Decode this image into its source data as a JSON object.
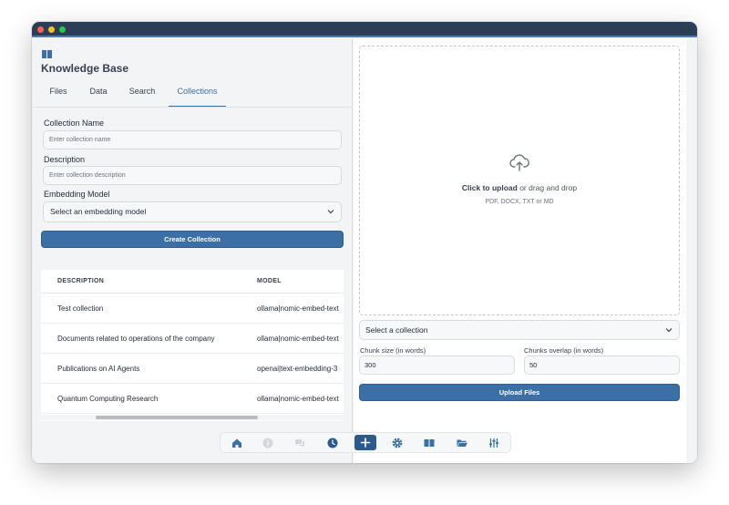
{
  "app": {
    "title": "Knowledge Base"
  },
  "tabs": [
    {
      "label": "Files"
    },
    {
      "label": "Data"
    },
    {
      "label": "Search"
    },
    {
      "label": "Collections",
      "active": true
    }
  ],
  "form": {
    "collection_name_label": "Collection Name",
    "collection_name_placeholder": "Enter collection name",
    "description_label": "Description",
    "description_placeholder": "Enter collection description",
    "embedding_model_label": "Embedding Model",
    "embedding_model_value": "Select an embedding model",
    "create_button": "Create Collection"
  },
  "table": {
    "headers": [
      "DESCRIPTION",
      "MODEL"
    ],
    "rows": [
      {
        "description": "Test collection",
        "model": "ollama|nomic-embed-text"
      },
      {
        "description": "Documents related to operations of the company",
        "model": "ollama|nomic-embed-text"
      },
      {
        "description": "Publications on AI Agents",
        "model": "openai|text-embedding-3"
      },
      {
        "description": "Quantum Computing Research",
        "model": "ollama|nomic-embed-text"
      }
    ]
  },
  "upload": {
    "click_text": "Click to upload",
    "drag_text": " or drag and drop",
    "formats": "PDF, DOCX, TXT or MD",
    "collection_select": "Select a collection",
    "chunk_size_label": "Chunk size (in words)",
    "chunk_size_value": "300",
    "chunk_overlap_label": "Chunks overlap (in words)",
    "chunk_overlap_value": "50",
    "upload_button": "Upload Files"
  },
  "dock": {
    "icons": [
      "home-icon",
      "info-icon",
      "chat-icon",
      "history-icon",
      "add-icon",
      "settings-icon",
      "book-icon",
      "folder-icon",
      "sliders-icon"
    ],
    "active": "add-icon"
  },
  "colors": {
    "accent": "#3b6fa6",
    "titlebar": "#2c3e55"
  }
}
